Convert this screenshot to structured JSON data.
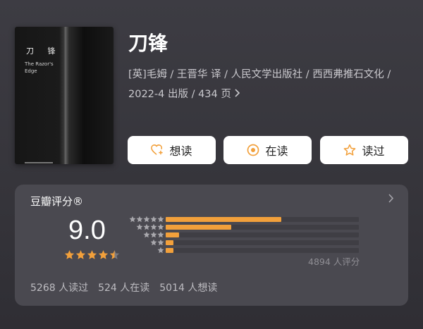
{
  "book": {
    "cover": {
      "title": "刀 锋",
      "subtitle_en": "The Razor's\nEdge"
    },
    "title": "刀锋",
    "meta_line1": "[英]毛姆 / 王晋华 译 / 人民文学出版社 / 西西弗推石文化 /",
    "meta_line2": "2022-4 出版 / 434 页"
  },
  "actions": {
    "want_label": "想读",
    "reading_label": "在读",
    "read_label": "读过",
    "want_icon": "heart-plus-icon",
    "reading_icon": "target-circle-icon",
    "read_icon": "star-outline-icon"
  },
  "rating": {
    "label": "豆瓣评分®",
    "score": "9.0",
    "stars": 4.5,
    "breakdown": [
      {
        "stars": 5,
        "percent": 0.6
      },
      {
        "stars": 4,
        "percent": 0.34
      },
      {
        "stars": 3,
        "percent": 0.07
      },
      {
        "stars": 2,
        "percent": 0.04
      },
      {
        "stars": 1,
        "percent": 0.04
      }
    ],
    "count_text": "4894 人评分",
    "read_count": "5268 人读过",
    "reading_count": "524 人在读",
    "want_count": "5014 人想读"
  },
  "colors": {
    "accent_orange": "#f2a03b",
    "card_bg": "#4a4950"
  }
}
